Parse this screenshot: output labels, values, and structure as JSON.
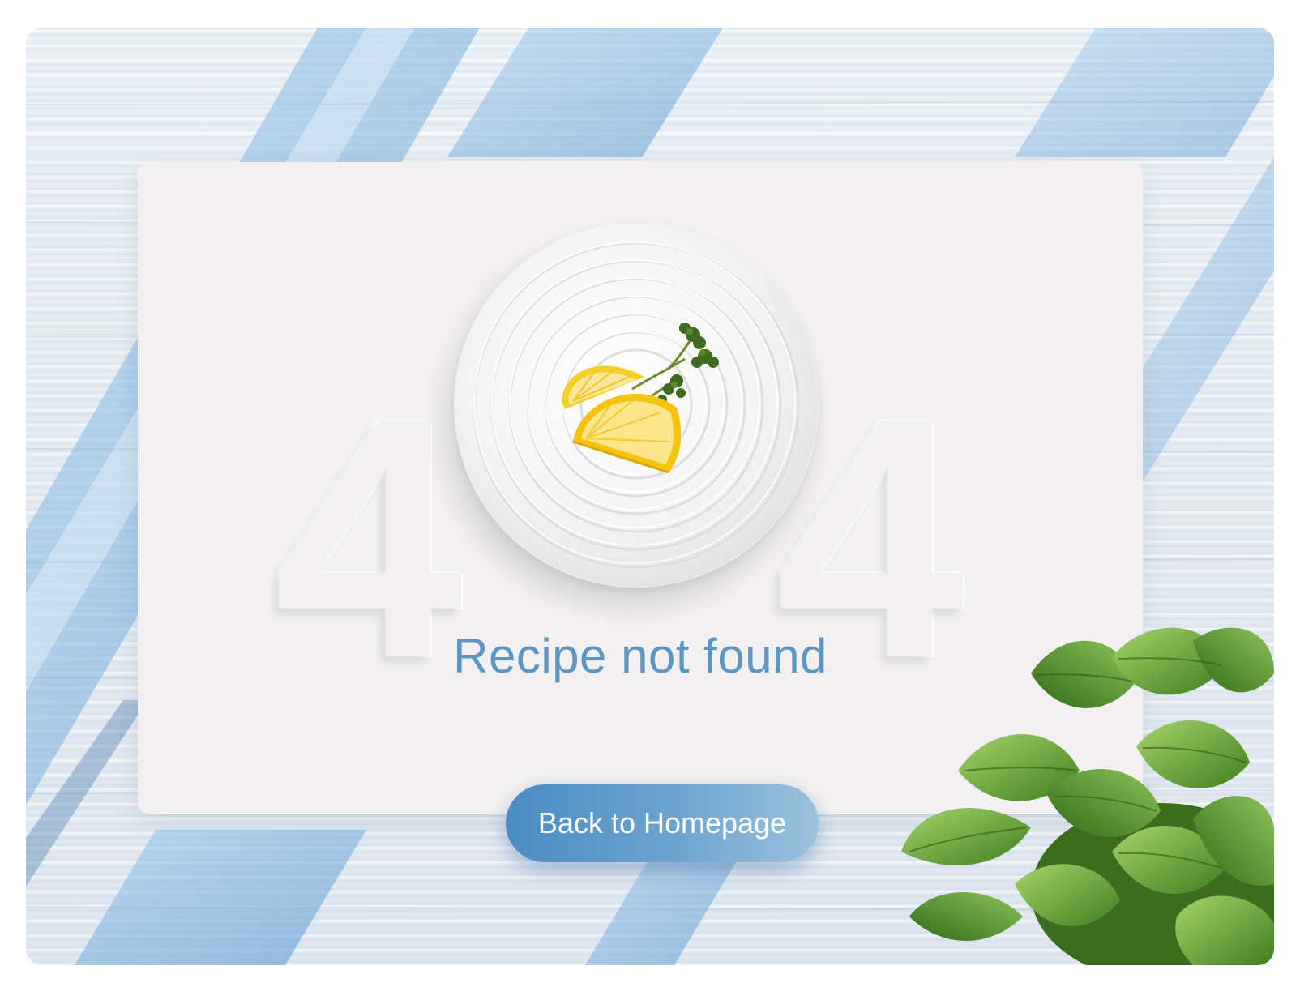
{
  "page": {
    "error_code_first": "4",
    "error_code_last": "4",
    "message": "Recipe not found",
    "back_button_label": "Back to Homepage"
  },
  "colors": {
    "accent": "#5b96c4",
    "button_start": "#4a8cc4",
    "button_end": "#9cc2de",
    "card": "#f2f0f1",
    "stripe": "#8dbde3"
  },
  "icons": {
    "plate": "plate-illustration",
    "lemon": "lemon-garnish-illustration",
    "basil": "basil-plant-illustration"
  }
}
